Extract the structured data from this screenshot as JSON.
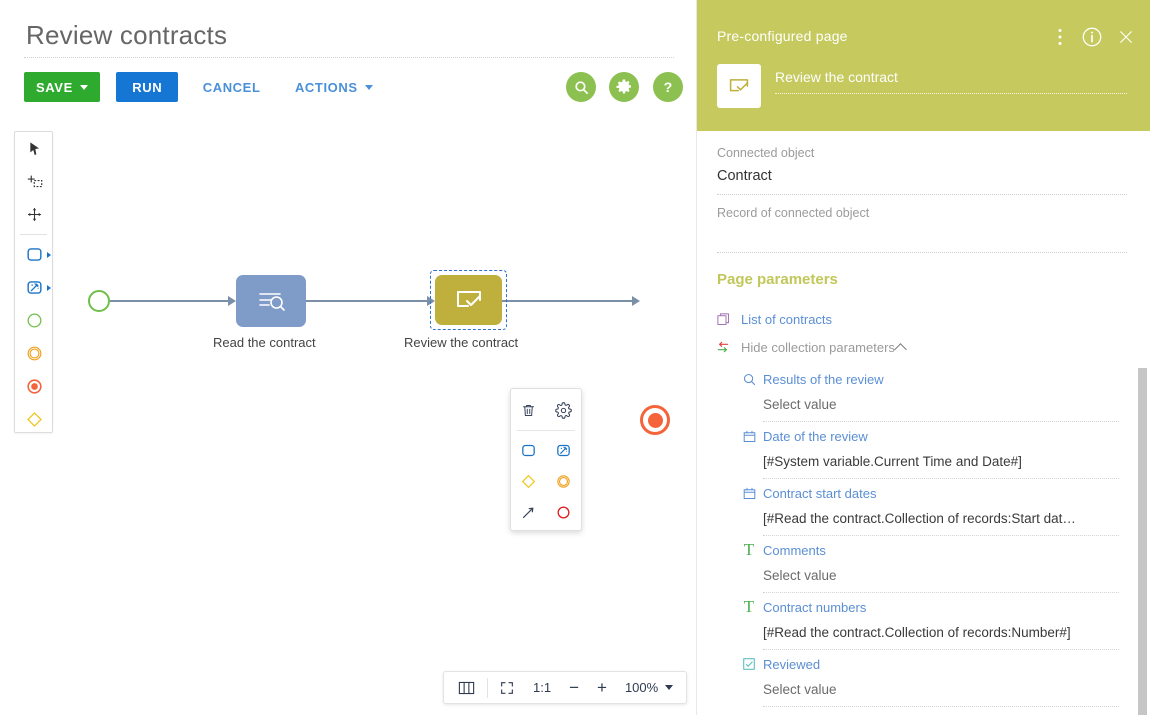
{
  "page": {
    "title": "Review contracts"
  },
  "toolbar": {
    "save_label": "SAVE",
    "run_label": "RUN",
    "cancel_label": "CANCEL",
    "actions_label": "ACTIONS",
    "icons": [
      {
        "name": "search-icon",
        "glyph": "search"
      },
      {
        "name": "gear-icon",
        "glyph": "gear"
      },
      {
        "name": "help-icon",
        "glyph": "question"
      }
    ],
    "colors": {
      "save": "#2eab2e",
      "run": "#1676d4",
      "link": "#4a90d9",
      "round_icon": "#8cc152"
    }
  },
  "palette": {
    "items": [
      {
        "name": "pointer-tool",
        "icon": "cursor-arrow-icon",
        "has_chevron": false
      },
      {
        "name": "add-selection-tool",
        "icon": "add-selection-icon",
        "has_chevron": false
      },
      {
        "name": "pan-tool",
        "icon": "move-cross-icon",
        "has_chevron": false
      },
      {
        "name": "task-element",
        "icon": "rounded-rectangle-icon",
        "has_chevron": true
      },
      {
        "name": "action-element",
        "icon": "magic-wand-square-icon",
        "has_chevron": true
      },
      {
        "name": "start-event-element",
        "icon": "green-circle-icon",
        "has_chevron": false
      },
      {
        "name": "intermediate-event-element",
        "icon": "orange-double-circle-icon",
        "has_chevron": false
      },
      {
        "name": "end-event-element",
        "icon": "red-filled-circle-icon",
        "has_chevron": false
      },
      {
        "name": "gateway-element",
        "icon": "yellow-diamond-icon",
        "has_chevron": false
      }
    ]
  },
  "diagram": {
    "nodes": [
      {
        "name": "start-event",
        "label": ""
      },
      {
        "name": "read-contract-task",
        "label": "Read the contract",
        "icon": "read-records-icon",
        "color": "#7f9cc8"
      },
      {
        "name": "review-contract-task",
        "label": "Review the contract",
        "icon": "page-check-icon",
        "color": "#bfb03e",
        "selected": true
      },
      {
        "name": "end-event",
        "label": "",
        "color": "#f4633a"
      }
    ]
  },
  "context_menu": {
    "items": [
      {
        "name": "delete-element",
        "icon": "trash-icon"
      },
      {
        "name": "element-settings",
        "icon": "gear-icon"
      },
      {
        "name": "add-task",
        "icon": "rounded-rectangle-icon"
      },
      {
        "name": "add-action",
        "icon": "magic-wand-square-icon"
      },
      {
        "name": "add-gateway",
        "icon": "yellow-diamond-icon"
      },
      {
        "name": "add-intermediate-event",
        "icon": "orange-ring-icon"
      },
      {
        "name": "add-connector",
        "icon": "arrow-icon"
      },
      {
        "name": "add-end-event",
        "icon": "red-ring-icon"
      }
    ]
  },
  "zoom_bar": {
    "lanes_icon": "lanes-icon",
    "fit_icon": "fit-to-screen-icon",
    "actual_size_label": "1:1",
    "zoom_out_label": "−",
    "zoom_in_label": "+",
    "zoom_level": "100%"
  },
  "panel": {
    "header": {
      "title": "Pre-configured page",
      "node_name": "Review the contract",
      "node_icon": "page-check-icon",
      "background": "#c5c95e",
      "actions": [
        {
          "name": "panel-more-menu",
          "icon": "vertical-dots-icon"
        },
        {
          "name": "panel-info",
          "icon": "info-circle-icon"
        },
        {
          "name": "panel-close",
          "icon": "close-icon"
        }
      ]
    },
    "fields": [
      {
        "name": "connected-object",
        "label": "Connected object",
        "value": "Contract"
      },
      {
        "name": "record-of-connected-object",
        "label": "Record of connected object",
        "value": ""
      }
    ],
    "section_title": "Page parameters",
    "collection": {
      "name_label": "List of contracts",
      "name_icon": "stacked-pages-icon",
      "toggle_label": "Hide collection parameters",
      "toggle_icon": "exchange-arrows-icon",
      "toggle_chevron": "chevron-up-icon"
    },
    "parameters": [
      {
        "name": "results-of-the-review",
        "icon": "lookup-magnifier-icon",
        "icon_color": "#5b8fd4",
        "label": "Results of the review",
        "value": "Select value",
        "value_is_placeholder": true
      },
      {
        "name": "date-of-the-review",
        "icon": "calendar-icon",
        "icon_color": "#5b8fd4",
        "label": "Date of the review",
        "value": "[#System variable.Current Time and Date#]",
        "value_is_placeholder": false
      },
      {
        "name": "contract-start-dates",
        "icon": "calendar-icon",
        "icon_color": "#5b8fd4",
        "label": "Contract start dates",
        "value": "[#Read the contract.Collection of records:Start dat…",
        "value_is_placeholder": false
      },
      {
        "name": "comments",
        "icon": "text-t-icon",
        "icon_color": "#4caf50",
        "label": "Comments",
        "value": "Select value",
        "value_is_placeholder": true
      },
      {
        "name": "contract-numbers",
        "icon": "text-t-icon",
        "icon_color": "#4caf50",
        "label": "Contract numbers",
        "value": "[#Read the contract.Collection of records:Number#]",
        "value_is_placeholder": false
      },
      {
        "name": "reviewed",
        "icon": "checkbox-icon",
        "icon_color": "#3fb6b0",
        "label": "Reviewed",
        "value": "Select value",
        "value_is_placeholder": true
      }
    ]
  }
}
